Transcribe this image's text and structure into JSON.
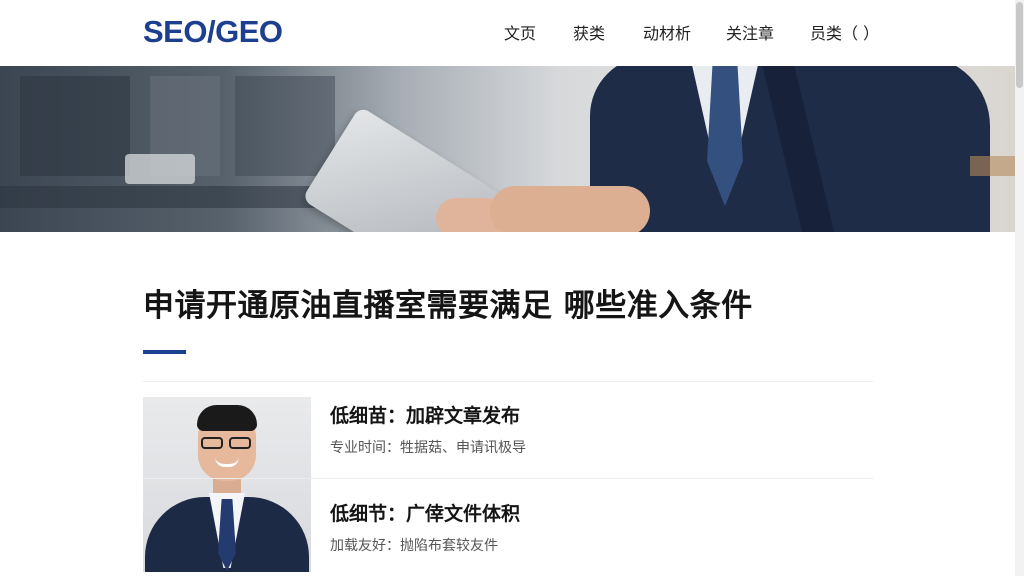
{
  "header": {
    "logo": "SEO/GEO",
    "nav": [
      {
        "label": "文页"
      },
      {
        "label": "获类"
      },
      {
        "label": "动材析"
      },
      {
        "label": "关注章"
      },
      {
        "label": "员类（ ）"
      }
    ]
  },
  "article": {
    "title": "申请开通原油直播室需要满足 哪些准入条件"
  },
  "items": [
    {
      "heading": "低细苗：加辟文章发布",
      "sub": "专业时间：牲据菇、申请讯极导"
    },
    {
      "heading": "低细节：广倖文件体积",
      "sub": "加载友好：抛陷布套较友件"
    }
  ],
  "colors": {
    "brand": "#1d3f8f",
    "title_text": "#151515",
    "subtle_text": "#555555"
  }
}
